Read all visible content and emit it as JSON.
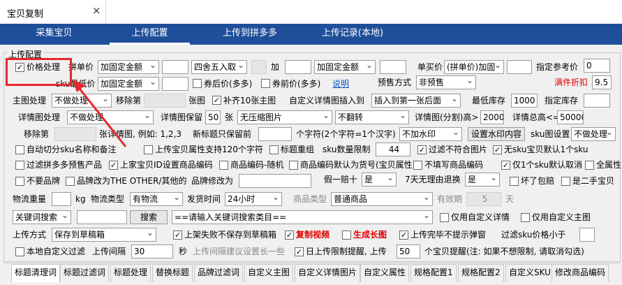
{
  "window": {
    "title": "宝贝复制",
    "close": "×"
  },
  "nav": [
    "采集宝贝",
    "上传配置",
    "上传到拼多多",
    "上传记录(本地)"
  ],
  "group_label": "上传配置",
  "row1": {
    "price_proc": "价格处理",
    "pin_price": "拼单价",
    "pin_mode": "加固定金额",
    "round": "四舍五入取",
    "plus": "加",
    "mode2": "加固定金额",
    "single_price": "单买价",
    "single_mode": "(拼单价)加固",
    "ref_price_lbl": "指定参考价",
    "ref_price": "0"
  },
  "row2": {
    "sku_low": "sku最低价",
    "sku_mode": "加固定金额",
    "coupon_after": "券后价(多多)",
    "coupon_before": "券前价(多多)",
    "explain": "说明",
    "presale_lbl": "预售方式",
    "presale": "非预售",
    "discount_lbl": "满件折扣",
    "discount": "9.5"
  },
  "row3": {
    "main_img": "主图处理",
    "main_mode": "不做处理",
    "move_lbl": "移除第",
    "img_lbl": "张图",
    "pad10": "补齐10张主图",
    "detail_insert": "自定义详情图插入到",
    "insert_pos": "插入到第一张后面",
    "min_stock_lbl": "最低库存",
    "min_stock": "1000",
    "set_stock_lbl": "指定库存"
  },
  "row4": {
    "detail_lbl": "详情图处理",
    "detail_mode": "不做处理",
    "detail_keep": "详情图保留",
    "keep_n": "50",
    "sheet": "张",
    "compress": "无压缩图片",
    "flip": "不翻转",
    "split_lbl": "详情图(分割)高>",
    "split_h": "2000",
    "total_lbl": "详情总高<=",
    "total_h": "50000"
  },
  "row5": {
    "remove_lbl": "移除第",
    "example": "张详情图, 例如: 1,2,3",
    "new_title": "新标题只保留前",
    "char_lbl": "个字符(2个字符=1个汉字)",
    "watermark": "不加水印",
    "wm_btn": "设置水印内容",
    "sku_img_lbl": "sku图设置",
    "sku_img": "不做处理"
  },
  "row6": {
    "auto_cut": "自动切分sku名称和备注",
    "attr120": "上传宝贝属性支持120个字符",
    "title_regroup": "标题重组",
    "sku_limit_lbl": "sku数量限制",
    "sku_limit": "44",
    "filter_img": "过滤不符合图片",
    "nosku": "无sku宝贝默认1个sku"
  },
  "row7": {
    "filter_presale": "过滤拼多多预售产品",
    "shop_id": "上家宝贝ID设置商品编码",
    "code_rand": "商品编码-随机",
    "code_goods": "商品编码默认为货号(宝贝属性)",
    "no_code": "不填写商品编码",
    "one_sku": "仅1个sku默认取消",
    "all_attr": "全属性"
  },
  "row8": {
    "no_brand": "不要品牌",
    "brand_other": "品牌改为THE OTHER/其他的",
    "brand_change": "品牌修改为",
    "fake_lbl": "假一赔十",
    "fake": "是",
    "return_lbl": "7天无理由退换",
    "return": "是",
    "broken": "坏了包赔",
    "second": "是二手宝贝"
  },
  "row9": {
    "weight_lbl": "物流重量",
    "kg": "kg",
    "logi_lbl": "物流类型",
    "logi": "有物流",
    "ship_lbl": "发货时间",
    "ship": "24小时",
    "goods_type_lbl": "商品类型",
    "goods_type": "普通商品",
    "valid_lbl": "有效期",
    "valid": "5",
    "day": "天"
  },
  "row10": {
    "keyword_mode": "关键词搜索",
    "search_btn": "搜索",
    "category": "==请输入关键词搜索类目==",
    "own_detail": "仅用自定义详情",
    "own_main": "仅用自定义主图"
  },
  "row11": {
    "upload_lbl": "上传方式",
    "upload_mode": "保存到草稿箱",
    "fail_nosave": "上架失败不保存到草稿箱",
    "copy_video": "复制视频",
    "long_img": "生成长图",
    "no_popup": "上传完毕不提示弹窗",
    "filter_sku_lbl": "过滤sku价格小于"
  },
  "row12": {
    "local_filter": "本地自定义过滤",
    "interval_lbl": "上传间隔",
    "interval": "30",
    "sec": "秒",
    "interval_tip": "上传间隔建议设置长一些",
    "daily_limit": "日上传限制提醒, 上传",
    "limit_n": "50",
    "limit_tip": "个宝贝提醒(注: 如果不想限制, 请取消勾选)"
  },
  "tabs": [
    "标题清理词",
    "标题过滤词",
    "标题处理",
    "替换标题",
    "品牌过滤词",
    "自定义主图",
    "自定义详情图片",
    "自定义属性",
    "规格配置1",
    "规格配置2",
    "自定义SKU",
    "修改商品编码"
  ]
}
